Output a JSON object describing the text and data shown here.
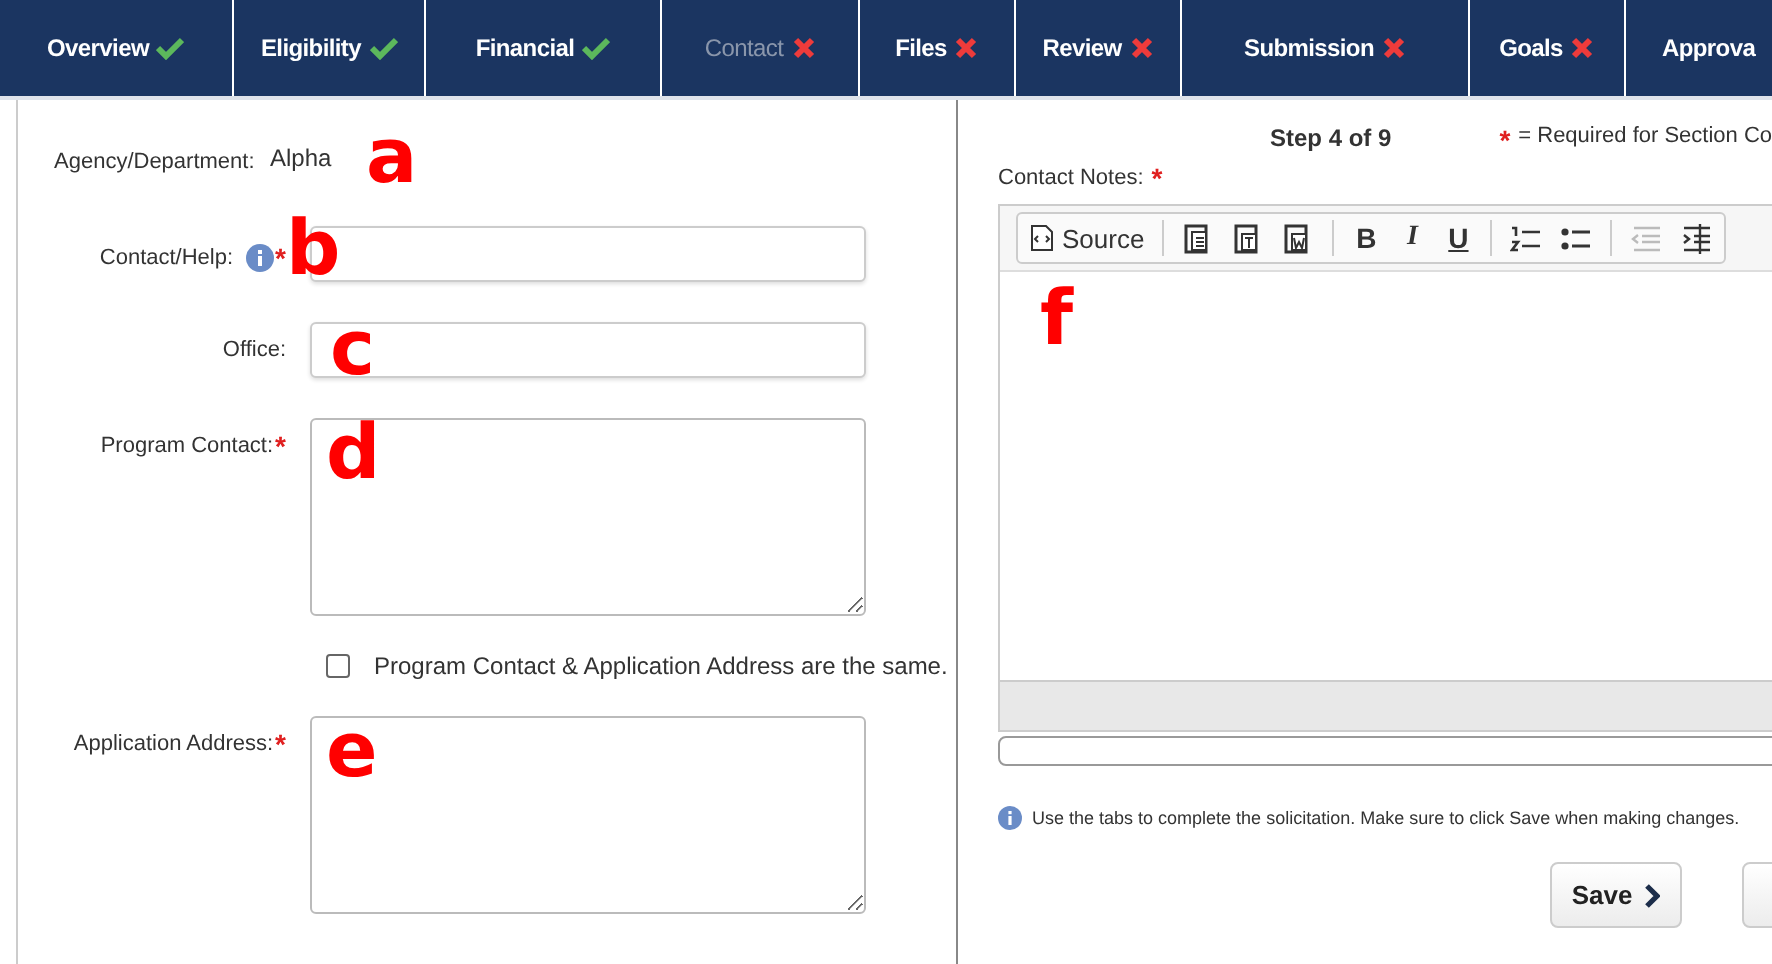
{
  "tabs": [
    {
      "label": "Overview",
      "complete": true,
      "selected": false
    },
    {
      "label": "Eligibility",
      "complete": true,
      "selected": false
    },
    {
      "label": "Financial",
      "complete": true,
      "selected": false
    },
    {
      "label": "Contact",
      "complete": false,
      "selected": true
    },
    {
      "label": "Files",
      "complete": false,
      "selected": false
    },
    {
      "label": "Review",
      "complete": false,
      "selected": false
    },
    {
      "label": "Submission",
      "complete": false,
      "selected": false
    },
    {
      "label": "Goals",
      "complete": false,
      "selected": false
    },
    {
      "label": "Approva",
      "selected": false
    }
  ],
  "form": {
    "fields": [
      {
        "kind": "static",
        "label": "Agency/Department:",
        "value": "Alpha",
        "annotation": "a"
      },
      {
        "kind": "text",
        "label": "Contact/Help:",
        "info": true,
        "required_mark": "*",
        "annotation": "b"
      },
      {
        "kind": "text",
        "label": "Office:",
        "info": false,
        "annotation": "c"
      },
      {
        "kind": "textarea",
        "label": "Program Contact:",
        "required_mark": "*",
        "annotation": "d"
      },
      {
        "kind": "checkbox",
        "label": "Program Contact & Application Address are the same.",
        "checked": false
      },
      {
        "kind": "textarea",
        "label": "Application Address:",
        "required_mark": "*",
        "annotation": "e"
      }
    ]
  },
  "step": "Step 4 of 9",
  "legend": {
    "star": "*",
    "text": "= Required for Section Co"
  },
  "notes": {
    "label": "Contact Notes:",
    "required_mark": "*",
    "annotation": "f",
    "toolbar": [
      {
        "kind": "source",
        "label": "Source"
      },
      {
        "kind": "sep"
      },
      {
        "kind": "paste"
      },
      {
        "kind": "paste-text"
      },
      {
        "kind": "paste-word"
      },
      {
        "kind": "sep"
      },
      {
        "kind": "bold",
        "label": "B"
      },
      {
        "kind": "italic",
        "label": "I"
      },
      {
        "kind": "underline",
        "label": "U"
      },
      {
        "kind": "sep"
      },
      {
        "kind": "numbered-list"
      },
      {
        "kind": "bulleted-list"
      },
      {
        "kind": "sep"
      },
      {
        "kind": "outdent",
        "disabled": true
      },
      {
        "kind": "indent",
        "disabled": false
      }
    ]
  },
  "hint": "Use the tabs to complete the solicitation. Make sure to click Save when making changes.",
  "buttons": [
    {
      "kind": "save",
      "label": "Save"
    },
    {
      "kind": "blank"
    }
  ]
}
